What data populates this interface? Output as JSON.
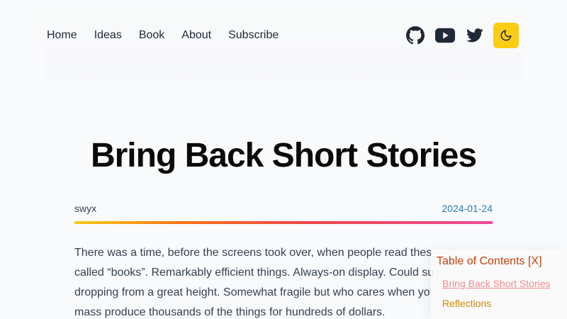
{
  "nav": {
    "links": [
      "Home",
      "Ideas",
      "Book",
      "About",
      "Subscribe"
    ]
  },
  "social": {
    "icons": [
      "github-icon",
      "youtube-icon",
      "twitter-icon"
    ],
    "theme_toggle_icon": "moon-icon",
    "theme_toggle_color": "#facc15"
  },
  "post": {
    "title": "Bring Back Short Stories",
    "author": "swyx",
    "date": "2024-01-24",
    "paragraph_lines": [
      "There was a time, before the screens took over, when people read thes",
      "called “books”. Remarkably efficient things. Always-on display. Could su",
      "dropping from a great height. Somewhat fragile but who cares when yo",
      "mass produce thousands of the things for hundreds of dollars."
    ]
  },
  "toc": {
    "title": "Table of Contents [X]",
    "items": [
      "Bring Back Short Stories",
      "Reflections"
    ]
  },
  "colors": {
    "background": "#f8fafc",
    "date": "#2b7bb9",
    "toc_title": "#c2410c",
    "toc_item_active": "#f08a8a",
    "toc_item": "#ca8a04"
  }
}
